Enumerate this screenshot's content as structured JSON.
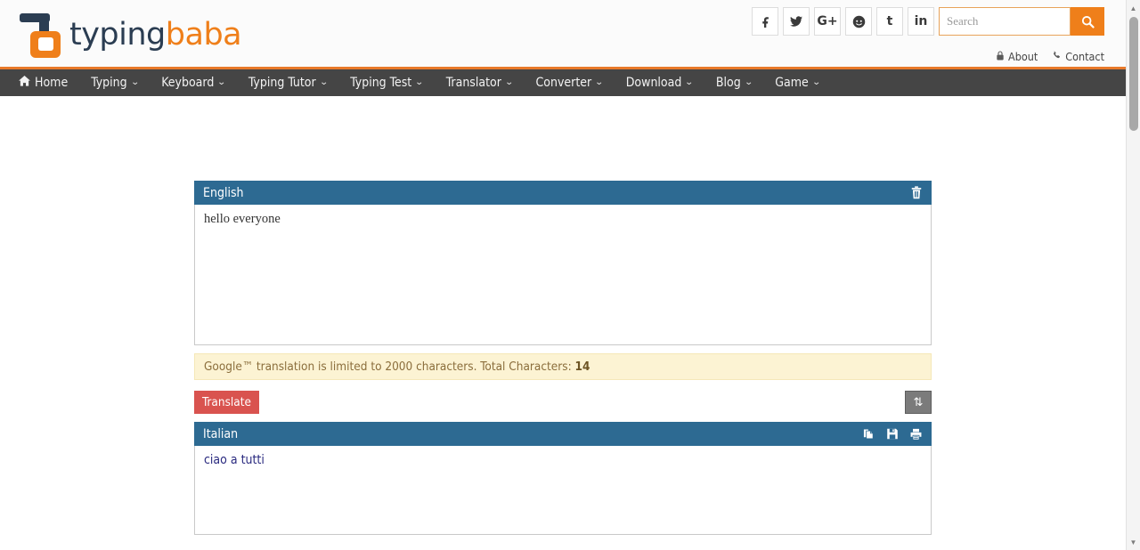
{
  "site": {
    "logo_text_dark": "typing",
    "logo_text_orange": "baba"
  },
  "topbar": {
    "social": [
      {
        "name": "facebook",
        "glyph": "f"
      },
      {
        "name": "twitter",
        "glyph": "twitter-bird"
      },
      {
        "name": "google-plus",
        "glyph": "G+"
      },
      {
        "name": "reddit",
        "glyph": "reddit-alien"
      },
      {
        "name": "tumblr",
        "glyph": "t"
      },
      {
        "name": "linkedin",
        "glyph": "in"
      }
    ],
    "search": {
      "placeholder": "Search",
      "value": "",
      "button_icon": "search-icon"
    },
    "links": [
      {
        "label": "About",
        "icon": "lock-icon"
      },
      {
        "label": "Contact",
        "icon": "phone-icon"
      }
    ]
  },
  "nav": {
    "items": [
      {
        "label": "Home",
        "icon": "home-icon",
        "has_caret": false
      },
      {
        "label": "Typing",
        "has_caret": true
      },
      {
        "label": "Keyboard",
        "has_caret": true
      },
      {
        "label": "Typing Tutor",
        "has_caret": true
      },
      {
        "label": "Typing Test",
        "has_caret": true
      },
      {
        "label": "Translator",
        "has_caret": true
      },
      {
        "label": "Converter",
        "has_caret": true
      },
      {
        "label": "Download",
        "has_caret": true
      },
      {
        "label": "Blog",
        "has_caret": true
      },
      {
        "label": "Game",
        "has_caret": true
      }
    ],
    "caret_glyph": "⌄"
  },
  "translator": {
    "source": {
      "language": "English",
      "text": "hello everyone",
      "clear_icon": "trash-icon"
    },
    "notice": {
      "text": "Google™ translation is limited to 2000 characters. Total Characters:",
      "count": "14"
    },
    "translate_button": "Translate",
    "swap_button": {
      "icon": "swap-vertical-icon",
      "glyph": "⇅"
    },
    "target": {
      "language": "Italian",
      "text": "ciao a tutti",
      "icons": [
        {
          "name": "copy-icon"
        },
        {
          "name": "save-icon"
        },
        {
          "name": "print-icon"
        }
      ]
    }
  },
  "scrollbar": {
    "up_glyph": "▲",
    "down_glyph": "▼"
  },
  "colors": {
    "brand_orange": "#ef7f1a",
    "nav_dark": "#454545",
    "panel_blue": "#2d6a92",
    "translate_red": "#d9534f",
    "notice_bg": "#fcf3d3"
  }
}
